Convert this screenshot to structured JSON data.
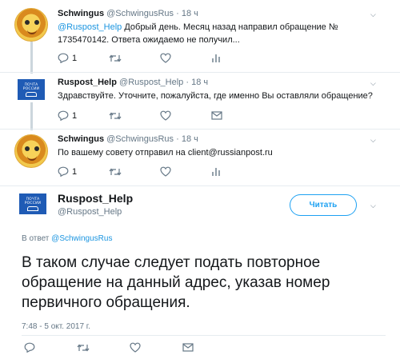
{
  "colors": {
    "accent": "#1da1f2",
    "mention": "#1b95e0",
    "secondary": "#657786",
    "thread_line": "#ccd6dd"
  },
  "tweets": [
    {
      "name": "Schwingus",
      "handle": "@SchwingusRus",
      "time": "· 18 ч",
      "mention": "@Ruspost_Help",
      "text_line1": " Добрый день. Месяц назад направил обращение №",
      "text_line2": "1735470142. Ответа ожидаемо не получил...",
      "reply_count": "1",
      "icons": [
        "reply-icon",
        "retweet-icon",
        "like-icon",
        "analytics-icon"
      ]
    },
    {
      "name": "Ruspost_Help",
      "handle": "@Ruspost_Help",
      "time": "· 18 ч",
      "text_line1": "Здравствуйте. Уточните, пожалуйста, где именно Вы оставляли обращение?",
      "reply_count": "1",
      "icons": [
        "reply-icon",
        "retweet-icon",
        "like-icon",
        "mail-icon"
      ]
    },
    {
      "name": "Schwingus",
      "handle": "@SchwingusRus",
      "time": "· 18 ч",
      "text_line1": "По вашему совету отправил на client@russianpost.ru",
      "reply_count": "1",
      "icons": [
        "reply-icon",
        "retweet-icon",
        "like-icon",
        "analytics-icon"
      ]
    }
  ],
  "logo_text": "ПОЧТА РОССИИ",
  "main_tweet": {
    "name": "Ruspost_Help",
    "handle": "@Ruspost_Help",
    "follow_label": "Читать",
    "reply_prefix": "В ответ ",
    "reply_to": "@SchwingusRus",
    "text": "В таком случае следует подать повторное обращение на данный адрес, указав номер первичного обращения.",
    "timestamp": "7:48 - 5 окт. 2017 г.",
    "icons": [
      "reply-icon",
      "retweet-icon",
      "like-icon",
      "mail-icon"
    ]
  }
}
